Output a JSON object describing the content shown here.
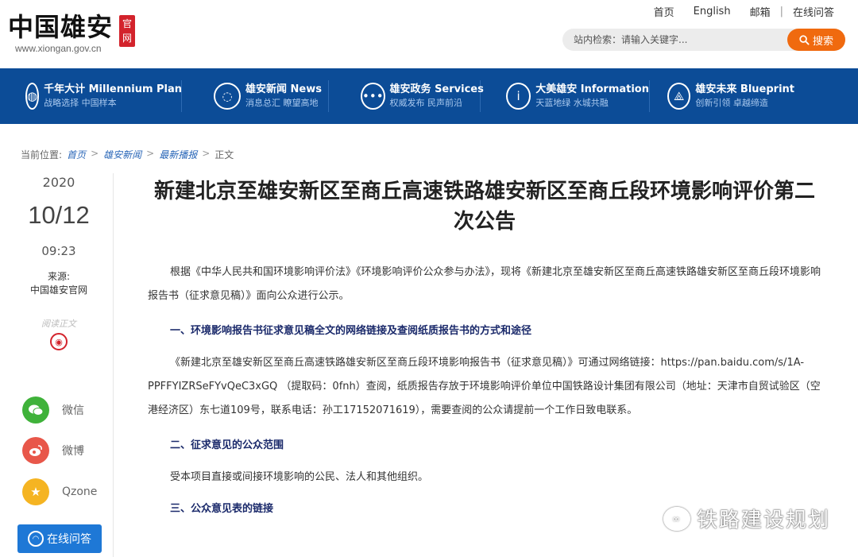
{
  "header": {
    "logo_text": "中国雄安",
    "logo_seal": "官网",
    "logo_url": "www.xiongan.gov.cn",
    "links": [
      "首页",
      "English",
      "邮箱",
      "在线问答"
    ],
    "search_placeholder": "站内检索：请输入关键字...",
    "search_button": "搜索"
  },
  "nav": {
    "items": [
      {
        "title": "千年大计 Millennium Plan",
        "sub": "战略选择 中国样本",
        "icon": "globe-icon",
        "glyph": "◍"
      },
      {
        "title": "雄安新闻 News",
        "sub": "消息总汇 瞭望高地",
        "icon": "news-icon",
        "glyph": "◌"
      },
      {
        "title": "雄安政务 Services",
        "sub": "权威发布 民声前沿",
        "icon": "chat-icon",
        "glyph": "•••"
      },
      {
        "title": "大美雄安 Information",
        "sub": "天蓝地绿 水城共融",
        "icon": "info-icon",
        "glyph": "i"
      },
      {
        "title": "雄安未来 Blueprint",
        "sub": "创新引领 卓越缔造",
        "icon": "compass-icon",
        "glyph": "⟁"
      }
    ]
  },
  "breadcrumb": {
    "label": "当前位置:",
    "items": [
      "首页",
      "雄安新闻",
      "最新播报"
    ],
    "current": "正文",
    "sep": ">"
  },
  "meta": {
    "year": "2020",
    "date": "10/12",
    "time": "09:23",
    "source_label": "来源:",
    "source": "中国雄安官网",
    "read_label": "阅读正文"
  },
  "share": {
    "items": [
      {
        "label": "微信",
        "color": "#3fb23a",
        "icon": "wechat-icon"
      },
      {
        "label": "微博",
        "color": "#e8574a",
        "icon": "weibo-icon"
      },
      {
        "label": "Qzone",
        "color": "#f5b422",
        "icon": "qzone-icon"
      }
    ],
    "online_label": "在线问答"
  },
  "article": {
    "title": "新建北京至雄安新区至商丘高速铁路雄安新区至商丘段环境影响评价第二次公告",
    "p1": "根据《中华人民共和国环境影响评价法》《环境影响评价公众参与办法》，现将《新建北京至雄安新区至商丘高速铁路雄安新区至商丘段环境影响报告书（征求意见稿）》面向公众进行公示。",
    "h1": "一、环境影响报告书征求意见稿全文的网络链接及查阅纸质报告书的方式和途径",
    "p2": "《新建北京至雄安新区至商丘高速铁路雄安新区至商丘段环境影响报告书（征求意见稿）》可通过网络链接：https://pan.baidu.com/s/1A-PPFFYIZRSeFYvQeC3xGQ （提取码：0fnh）查阅，纸质报告存放于环境影响评价单位中国铁路设计集团有限公司（地址：天津市自贸试验区（空港经济区）东七道109号，联系电话：孙工17152071619），需要查阅的公众请提前一个工作日致电联系。",
    "h2": "二、征求意见的公众范围",
    "p3": "受本项目直接或间接环境影响的公民、法人和其他组织。",
    "h3": "三、公众意见表的链接"
  },
  "watermark": {
    "text": "铁路建设规划",
    "icon": "wechat-icon"
  },
  "colors": {
    "nav_bg": "#0c4c97",
    "search_button": "#f06a0f",
    "seal": "#d3232c",
    "heading_text": "#1b2a6b",
    "online_button": "#1e78d6"
  }
}
